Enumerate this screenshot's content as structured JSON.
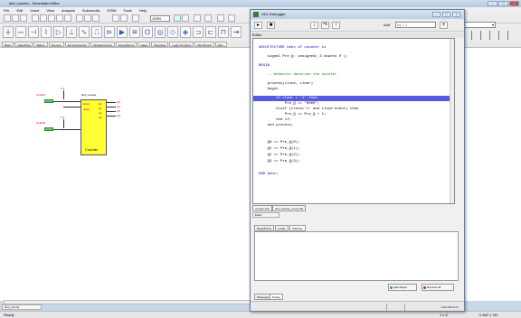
{
  "main_window": {
    "title": "shd_counter - Schematic Editor",
    "menu": [
      "File",
      "Edit",
      "Insert",
      "View",
      "Analysis",
      "Subcircuits",
      "DSIM",
      "Tools",
      "Help"
    ],
    "zoom": "100%",
    "library_tabs": [
      "Basic",
      "Gates/Digi",
      "Meters",
      "Sources",
      "Semiconductors",
      "Optoelectronics",
      "Opto-Macros",
      "Gates",
      "Flip-Flops",
      "Logic ICs-HCux",
      "MC-DA-CR",
      "Misc."
    ],
    "dropdown_value": "Ground",
    "doc_tab": "shd_counter",
    "status_left": "Ready",
    "status_coords": "5 x 6",
    "status_zoom": "0 662 1 311",
    "status_mid": "1 x 6"
  },
  "schematic": {
    "block_title": "shd_counter",
    "block_label": "Counter",
    "inputs": [
      {
        "label": "CLOCK",
        "pin": "clock"
      },
      {
        "label": "CLEAR",
        "pin": "clear"
      }
    ],
    "vcc_labels": [
      "1.0",
      "1.0"
    ],
    "outputs": [
      "Q0",
      "Q1",
      "Q2",
      "Q3"
    ],
    "output_pins": [
      "q0",
      "q1",
      "q2",
      "q3"
    ]
  },
  "debugger": {
    "title": "HDL Debugger",
    "watch_label": "Add",
    "watch_value": "eq = 1",
    "editor_label": "Editor",
    "code_lines": [
      "",
      "ARCHITECTURE behv of counter is",
      "",
      "    signal Pre_Q: unsigned( 3 downto 0 );",
      "",
      "BEGIN",
      "",
      "    -- behavior describe the counter",
      "",
      "    process(clock, clear)",
      "    begin",
      "        if clear = '1' then",
      "            Pre_Q <= \"0000\";",
      "        elsif (clock='1' and clock'event) then",
      "            Pre_Q <= Pre_Q + 1;",
      "        end if;",
      "    end process;",
      "",
      "    Q0 <= Pre_Q(0);",
      "    Q1 <= Pre_Q(1);",
      "    Q2 <= Pre_Q(2);",
      "    Q3 <= Pre_Q(3);",
      "",
      "END behv;"
    ],
    "editor_tabs": [
      "counter.vhd",
      "shd_counter_comp.vhd"
    ],
    "editor_subtab": "Editor",
    "panel_tabs": [
      "BreakPoints",
      "Locals",
      "Watches"
    ],
    "add_object_label": "Add Object",
    "remove_all_label": "Remove All",
    "message_tabs": [
      "Messages",
      "Debug"
    ],
    "status_text": "Line:104 Col:1"
  }
}
